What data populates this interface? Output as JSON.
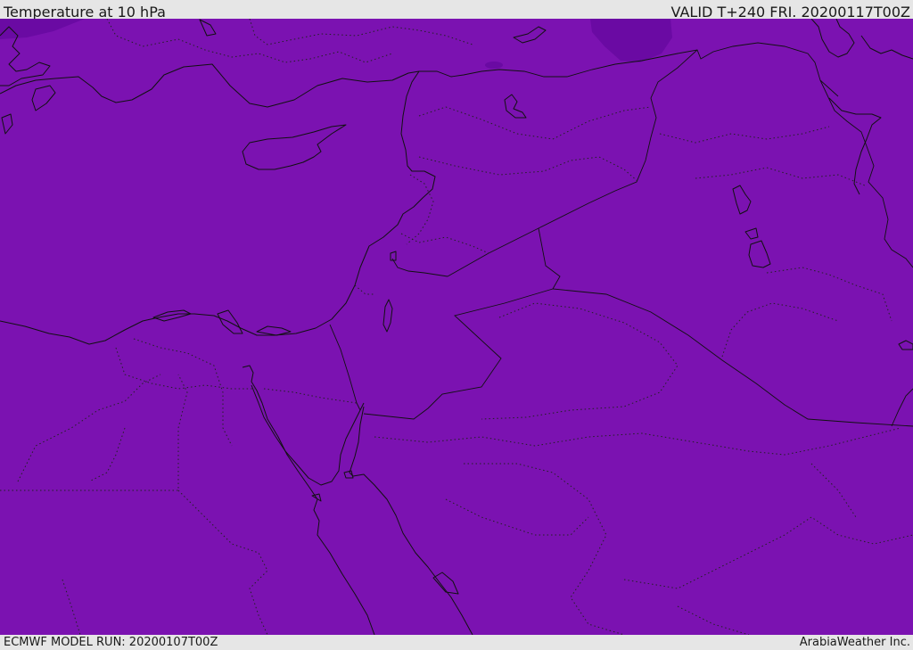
{
  "header": {
    "title": "Temperature at 10 hPa",
    "valid": "VALID T+240 FRI. 20200117T00Z"
  },
  "footer": {
    "model_run": "ECMWF MODEL RUN: 20200107T00Z",
    "provider": "ArabiaWeather Inc."
  },
  "map": {
    "fill_color": "#7b12b1",
    "cold_patch_color": "#6a0aa3",
    "line_color": "#111111"
  }
}
